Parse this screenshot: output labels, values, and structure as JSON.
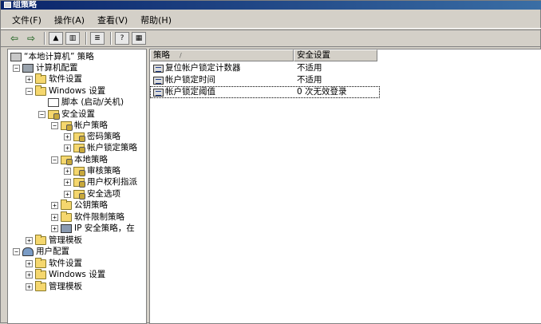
{
  "window": {
    "title": "组策略"
  },
  "menu": [
    {
      "label": "文件(F)"
    },
    {
      "label": "操作(A)"
    },
    {
      "label": "查看(V)"
    },
    {
      "label": "帮助(H)"
    }
  ],
  "tree": [
    {
      "label": "“本地计算机” 策略",
      "toggle": ""
    },
    {
      "label": "计算机配置",
      "toggle": "−"
    },
    {
      "label": "软件设置",
      "toggle": "+"
    },
    {
      "label": "Windows 设置",
      "toggle": "−"
    },
    {
      "label": "脚本 (启动/关机)",
      "toggle": ""
    },
    {
      "label": "安全设置",
      "toggle": "−"
    },
    {
      "label": "帐户策略",
      "toggle": "−"
    },
    {
      "label": "密码策略",
      "toggle": "+"
    },
    {
      "label": "帐户锁定策略",
      "toggle": "+"
    },
    {
      "label": "本地策略",
      "toggle": "−"
    },
    {
      "label": "审核策略",
      "toggle": "+"
    },
    {
      "label": "用户权利指派",
      "toggle": "+"
    },
    {
      "label": "安全选项",
      "toggle": "+"
    },
    {
      "label": "公钥策略",
      "toggle": "+"
    },
    {
      "label": "软件限制策略",
      "toggle": "+"
    },
    {
      "label": "IP 安全策略，在",
      "toggle": "+"
    },
    {
      "label": "管理模板",
      "toggle": "+"
    },
    {
      "label": "用户配置",
      "toggle": "−"
    },
    {
      "label": "软件设置",
      "toggle": "+"
    },
    {
      "label": "Windows 设置",
      "toggle": "+"
    },
    {
      "label": "管理模板",
      "toggle": "+"
    }
  ],
  "list": {
    "columns": [
      "策略",
      "安全设置"
    ],
    "sort_indicator": "/",
    "rows": [
      {
        "policy": "复位帐户锁定计数器",
        "setting": "不适用"
      },
      {
        "policy": "帐户锁定时间",
        "setting": "不适用"
      },
      {
        "policy": "帐户锁定阈值",
        "setting": "0 次无效登录"
      }
    ]
  }
}
